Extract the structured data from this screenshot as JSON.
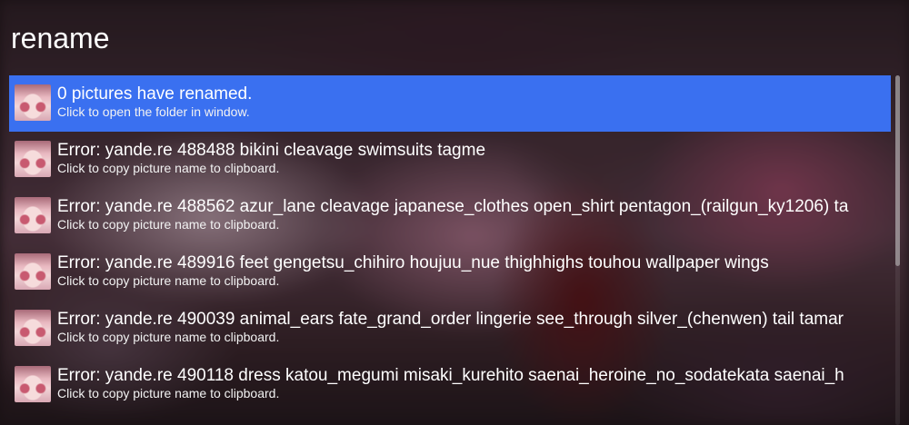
{
  "app": {
    "title": "rename"
  },
  "results": [
    {
      "icon": "picture-thumbnail-icon",
      "title": "0 pictures have renamed.",
      "subtitle": "Click to open the folder in window.",
      "selected": true
    },
    {
      "icon": "picture-thumbnail-icon",
      "title": "Error: yande.re 488488 bikini cleavage swimsuits tagme",
      "subtitle": "Click to copy picture name to clipboard.",
      "selected": false
    },
    {
      "icon": "picture-thumbnail-icon",
      "title": "Error: yande.re 488562 azur_lane cleavage japanese_clothes open_shirt pentagon_(railgun_ky1206) ta",
      "subtitle": "Click to copy picture name to clipboard.",
      "selected": false
    },
    {
      "icon": "picture-thumbnail-icon",
      "title": "Error: yande.re 489916 feet gengetsu_chihiro houjuu_nue thighhighs touhou wallpaper wings",
      "subtitle": "Click to copy picture name to clipboard.",
      "selected": false
    },
    {
      "icon": "picture-thumbnail-icon",
      "title": "Error: yande.re 490039 animal_ears fate_grand_order lingerie see_through silver_(chenwen) tail tamar",
      "subtitle": "Click to copy picture name to clipboard.",
      "selected": false
    },
    {
      "icon": "picture-thumbnail-icon",
      "title": "Error: yande.re 490118 dress katou_megumi misaki_kurehito saenai_heroine_no_sodatekata saenai_h",
      "subtitle": "Click to copy picture name to clipboard.",
      "selected": false
    }
  ],
  "colors": {
    "selection": "#3a70f0",
    "text": "#ffffff"
  }
}
